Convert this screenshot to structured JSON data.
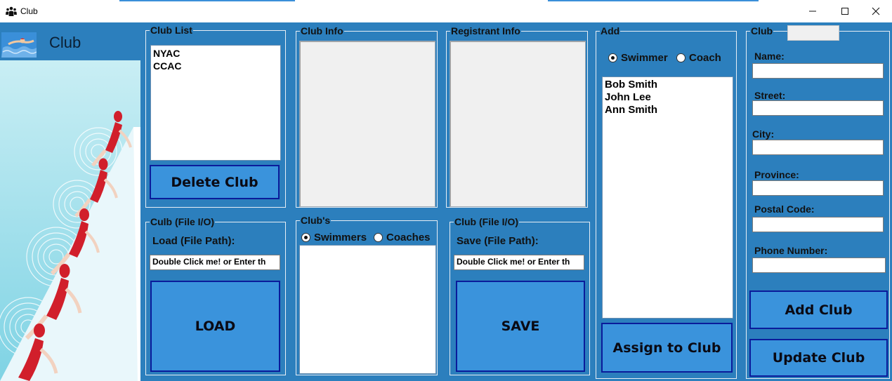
{
  "window": {
    "title": "Club",
    "icons": {
      "app": "people-icon",
      "minimize": "minimize-icon",
      "maximize": "maximize-icon",
      "close": "close-icon"
    }
  },
  "sidebar": {
    "app_label": "Club",
    "logo_icon": "swimmer-icon",
    "illustration": "swimmers-on-starting-blocks"
  },
  "club_list": {
    "legend": "Club List",
    "items": [
      "NYAC",
      "CCAC"
    ],
    "delete_button": "Delete Club"
  },
  "club_info": {
    "legend": "Club Info"
  },
  "registrant_info": {
    "legend": "Registrant Info"
  },
  "load_panel": {
    "legend": "Culb (File I/O)",
    "path_label": "Load (File Path):",
    "path_value": "Double Click me! or  Enter th",
    "button": "LOAD"
  },
  "clubs_members": {
    "legend": "Club's",
    "radio_swimmers": "Swimmers",
    "radio_coaches": "Coaches",
    "selected": "Swimmers"
  },
  "save_panel": {
    "legend": "Club (File I/O)",
    "path_label": "Save (File Path):",
    "path_value": "Double Click me! or  Enter th",
    "button": "SAVE"
  },
  "add_panel": {
    "legend": "Add",
    "radio_swimmer": "Swimmer",
    "radio_coach": "Coach",
    "selected": "Swimmer",
    "people": [
      "Bob Smith",
      "John Lee",
      "Ann Smith"
    ],
    "assign_button": "Assign to Club"
  },
  "club_form": {
    "legend": "Club",
    "name_label": "Name:",
    "street_label": "Street:",
    "city_label": "City:",
    "province_label": "Province:",
    "postal_label": "Postal Code:",
    "phone_label": "Phone Number:",
    "add_button": "Add Club",
    "update_button": "Update Club"
  },
  "colors": {
    "background": "#2c7fbd",
    "button": "#3a93dc",
    "button_border": "#0a1b9a"
  }
}
